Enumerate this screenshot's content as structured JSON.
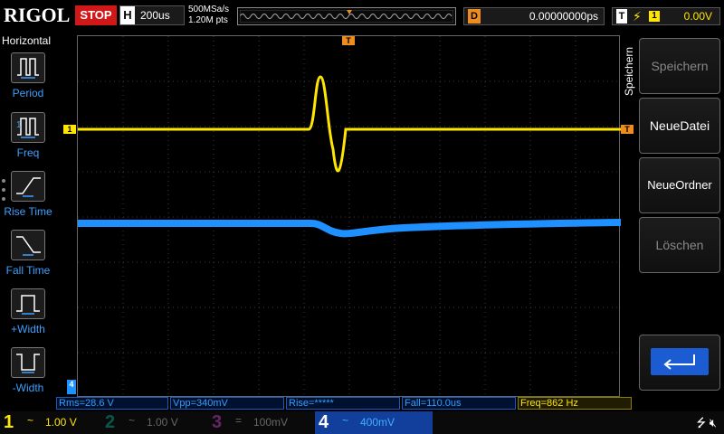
{
  "brand": "RIGOL",
  "run_status": "STOP",
  "timebase": {
    "key": "H",
    "value": "200us"
  },
  "sample": {
    "rate": "500MSa/s",
    "points": "1.20M pts"
  },
  "delay": {
    "key": "D",
    "value": "0.00000000ps"
  },
  "trigger": {
    "key": "T",
    "edge_icon": "rising-edge-icon",
    "source": "1",
    "level": "0.00V"
  },
  "left_menu": {
    "title": "Horizontal",
    "items": [
      {
        "label": "Period",
        "icon": "period-icon"
      },
      {
        "label": "Freq",
        "icon": "freq-icon"
      },
      {
        "label": "Rise Time",
        "icon": "rise-time-icon"
      },
      {
        "label": "Fall Time",
        "icon": "fall-time-icon"
      },
      {
        "label": "+Width",
        "icon": "positive-width-icon"
      },
      {
        "label": "-Width",
        "icon": "negative-width-icon"
      }
    ]
  },
  "right_menu": {
    "title": "Speichern",
    "buttons": [
      {
        "label": "Speichern",
        "state": "disabled"
      },
      {
        "label": "NeueDatei",
        "state": "enabled"
      },
      {
        "label": "NeueOrdner",
        "state": "enabled"
      },
      {
        "label": "Löschen",
        "state": "disabled"
      }
    ],
    "back_icon": "return-arrow-icon"
  },
  "measurements": [
    {
      "text": "Rms=28.6 V",
      "color": "blue"
    },
    {
      "text": "Vpp=340mV",
      "color": "blue"
    },
    {
      "text": "Rise=*****",
      "color": "blue"
    },
    {
      "text": "Fall=110.0us",
      "color": "blue"
    },
    {
      "text": "Freq=862 Hz",
      "color": "yellow"
    }
  ],
  "channels": [
    {
      "num": "1",
      "coupling": "~",
      "scale": "1.00 V",
      "active": true
    },
    {
      "num": "2",
      "coupling": "~",
      "scale": "1.00 V",
      "active": false
    },
    {
      "num": "3",
      "coupling": "=",
      "scale": "100mV",
      "active": false
    },
    {
      "num": "4",
      "coupling": "~",
      "scale": "400mV",
      "active": true
    }
  ],
  "markers": {
    "ch1": "1",
    "trigger_top": "T",
    "trigger_level": "T",
    "ch4": "4"
  },
  "status_icons": [
    "usb-icon",
    "speaker-muted-icon"
  ],
  "colors": {
    "ch1": "#ffe600",
    "ch4": "#1e90ff",
    "stop": "#d01818",
    "delay": "#f08c1e"
  }
}
